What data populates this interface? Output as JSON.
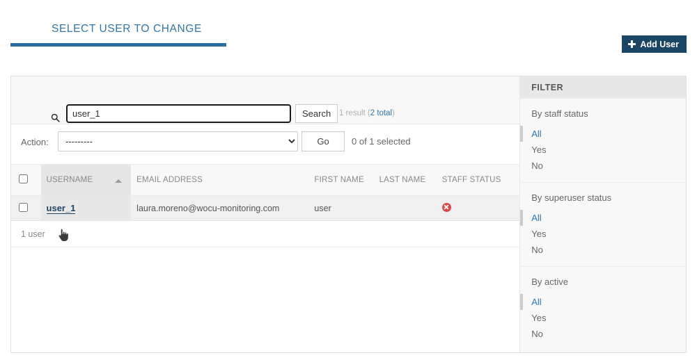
{
  "header": {
    "title": "SELECT USER TO CHANGE",
    "add_button_label": "Add User",
    "add_button_icon": "plus-icon",
    "accent_blue": "#2f76ab",
    "underline_blue": "#2b6ca3",
    "button_bg": "#1b4565"
  },
  "search": {
    "icon": "search-icon",
    "value": "user_1",
    "placeholder": "",
    "button_label": "Search",
    "result_prefix": "1 result (",
    "result_total_link": "2 total",
    "result_suffix": ")"
  },
  "action": {
    "label": "Action:",
    "selected_option": "---------",
    "options": [
      "---------"
    ],
    "go_label": "Go",
    "selection_status": "0 of 1 selected"
  },
  "table": {
    "columns": [
      {
        "key": "username",
        "label": "USERNAME",
        "sorted": true,
        "sort_direction": "asc"
      },
      {
        "key": "email",
        "label": "EMAIL ADDRESS",
        "sorted": false
      },
      {
        "key": "first_name",
        "label": "FIRST NAME",
        "sorted": false
      },
      {
        "key": "last_name",
        "label": "LAST NAME",
        "sorted": false
      },
      {
        "key": "staff_status",
        "label": "STAFF STATUS",
        "sorted": false
      }
    ],
    "rows": [
      {
        "checked": false,
        "username": "user_1",
        "email": "laura.moreno@wocu-monitoring.com",
        "first_name": "user",
        "last_name": "",
        "staff_status": false,
        "staff_status_icon": "cross-circle-icon"
      }
    ],
    "footer_count": "1 user"
  },
  "filter": {
    "header": "FILTER",
    "groups": [
      {
        "title": "By staff status",
        "options": [
          {
            "label": "All",
            "selected": true
          },
          {
            "label": "Yes",
            "selected": false
          },
          {
            "label": "No",
            "selected": false
          }
        ]
      },
      {
        "title": "By superuser status",
        "options": [
          {
            "label": "All",
            "selected": true
          },
          {
            "label": "Yes",
            "selected": false
          },
          {
            "label": "No",
            "selected": false
          }
        ]
      },
      {
        "title": "By active",
        "options": [
          {
            "label": "All",
            "selected": true
          },
          {
            "label": "Yes",
            "selected": false
          },
          {
            "label": "No",
            "selected": false
          }
        ]
      }
    ]
  },
  "cursor": {
    "type": "pointer-hand"
  }
}
